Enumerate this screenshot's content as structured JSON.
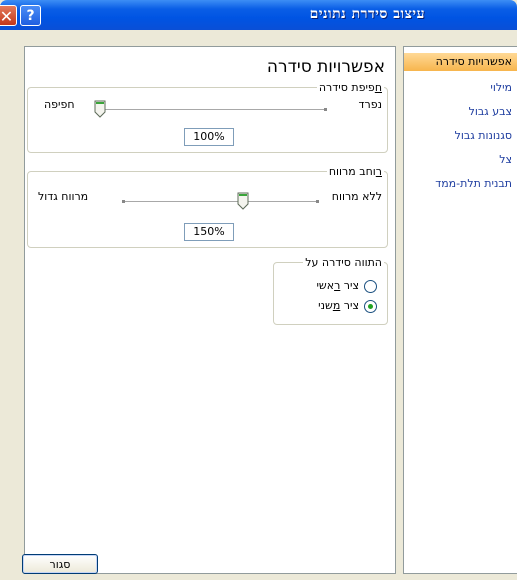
{
  "window": {
    "title": "עיצוב סידרת נתונים",
    "help": "?",
    "close": "✕"
  },
  "nav": {
    "items": [
      {
        "label": "אפשרויות סידרה",
        "selected": true
      },
      {
        "label": "מילוי",
        "selected": false
      },
      {
        "label": "צבע גבול",
        "selected": false
      },
      {
        "label": "סגנונות גבול",
        "selected": false
      },
      {
        "label": "צל",
        "selected": false
      },
      {
        "label": "תבנית תלת-ממד",
        "selected": false
      }
    ]
  },
  "panel": {
    "title": "אפשרויות סידרה",
    "overlap": {
      "legend_mnemonic": "ח",
      "legend_rest": "פיפת סידרה",
      "left_label": "חפיפה",
      "right_label": "נפרד",
      "value": "100%"
    },
    "gap_width": {
      "legend_mnemonic": "ר",
      "legend_rest": "וחב מרווח",
      "left_label": "מרווח גדול",
      "right_label": "ללא מרווח",
      "value": "150%"
    },
    "plot_on": {
      "legend": "התווה סידרה על",
      "primary_prefix": "ציר ",
      "primary_mnemonic": "ר",
      "primary_suffix": "אשי",
      "primary_selected": false,
      "secondary_prefix": "ציר ",
      "secondary_mnemonic": "מ",
      "secondary_suffix": "שני",
      "secondary_selected": true
    }
  },
  "footer": {
    "close_label": "סגור"
  },
  "colors": {
    "titlebar": "#0054e3",
    "selected_nav": "#f7b54d",
    "link_blue": "#1f3ea0"
  }
}
